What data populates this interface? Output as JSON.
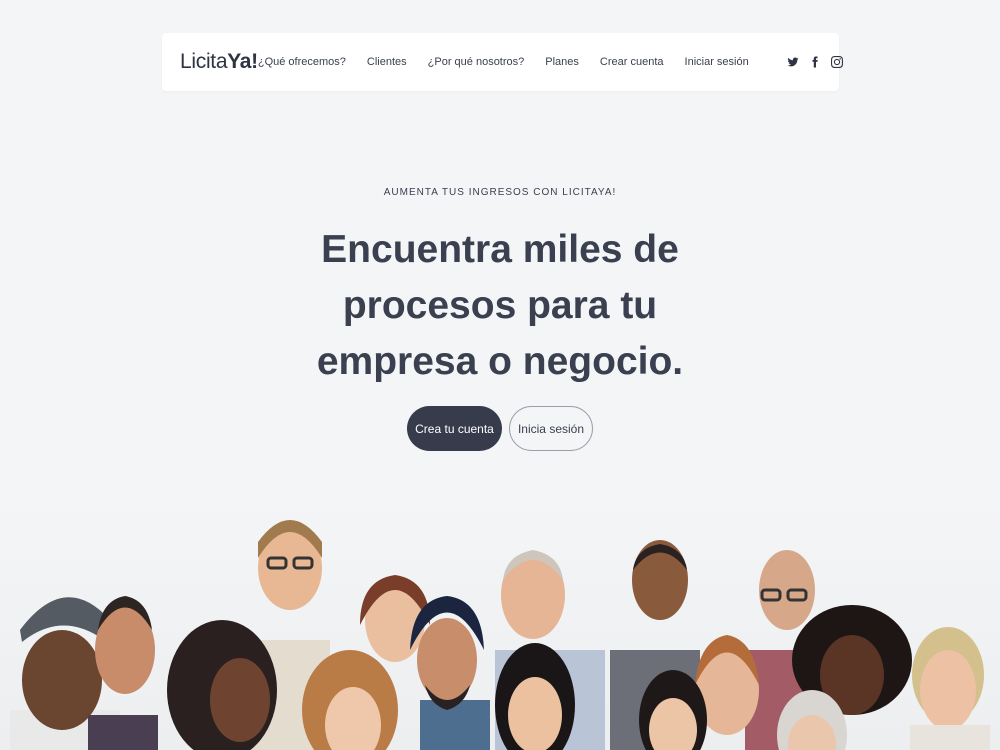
{
  "header": {
    "logo_main": "Licita",
    "logo_accent": "Ya!",
    "nav": [
      {
        "label": "¿Qué ofrecemos?"
      },
      {
        "label": "Clientes"
      },
      {
        "label": "¿Por qué nosotros?"
      },
      {
        "label": "Planes"
      },
      {
        "label": "Crear cuenta"
      },
      {
        "label": "Iniciar sesión"
      }
    ],
    "socials": [
      "twitter-icon",
      "facebook-icon",
      "instagram-icon"
    ]
  },
  "hero": {
    "eyebrow": "AUMENTA TUS INGRESOS CON LICITAYA!",
    "headline": "Encuentra miles de procesos para tu empresa o negocio.",
    "primary_cta": "Crea tu cuenta",
    "secondary_cta": "Inicia sesión"
  },
  "colors": {
    "background": "#f4f5f6",
    "text": "#3a4050",
    "primary_button": "#363c4c"
  }
}
